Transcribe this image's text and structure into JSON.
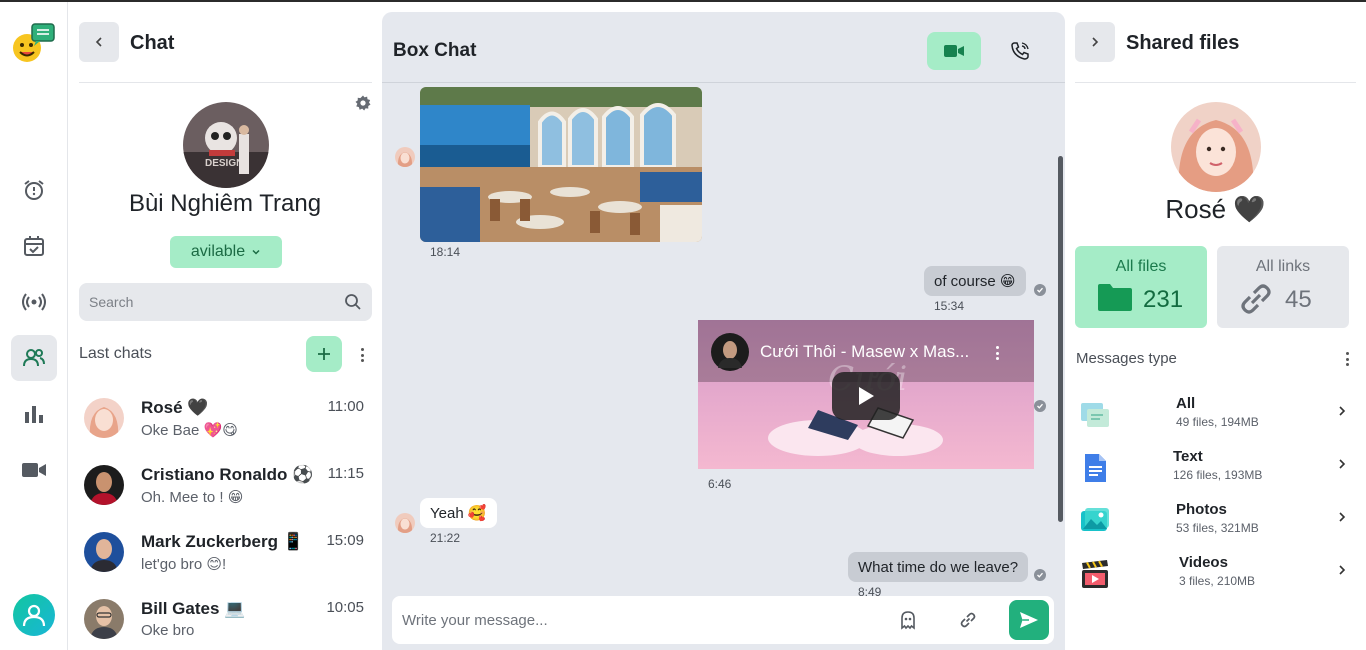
{
  "chat_panel": {
    "title": "Chat",
    "profile": {
      "name": "Bùi Nghiêm Trang",
      "status": "avilable"
    },
    "search": {
      "placeholder": "Search"
    },
    "last_chats_label": "Last chats",
    "chats": [
      {
        "name": "Rosé 🖤",
        "time": "11:00",
        "preview": "Oke Bae 💖😋"
      },
      {
        "name": "Cristiano Ronaldo ⚽",
        "time": "11:15",
        "preview": "Oh. Mee to ! 😁"
      },
      {
        "name": "Mark Zuckerberg 📱",
        "time": "15:09",
        "preview": "let'go bro 😊!"
      },
      {
        "name": "Bill Gates 💻",
        "time": "10:05",
        "preview": "Oke bro"
      }
    ]
  },
  "box_chat": {
    "title": "Box Chat",
    "messages": [
      {
        "type": "photo",
        "direction": "in",
        "time": "18:14"
      },
      {
        "type": "text",
        "direction": "out",
        "text": "of course 😁",
        "time": "15:34"
      },
      {
        "type": "video",
        "direction": "out",
        "video_title": "Cưới Thôi - Masew x Mas...",
        "time": "6:46"
      },
      {
        "type": "text",
        "direction": "in",
        "text": "Yeah 🥰",
        "time": "21:22"
      },
      {
        "type": "text",
        "direction": "out",
        "text": "What time do we leave?",
        "time": "8:49"
      }
    ],
    "composer": {
      "placeholder": "Write your message..."
    }
  },
  "files_panel": {
    "title": "Shared files",
    "contact": {
      "name": "Rosé 🖤"
    },
    "all_files": {
      "label": "All files",
      "count": "231"
    },
    "all_links": {
      "label": "All links",
      "count": "45"
    },
    "messages_type_label": "Messages type",
    "types": [
      {
        "name": "All",
        "meta": "49 files, 194MB",
        "icon": "all-files-icon"
      },
      {
        "name": "Text",
        "meta": "126 files, 193MB",
        "icon": "document-icon"
      },
      {
        "name": "Photos",
        "meta": "53 files, 321MB",
        "icon": "photo-icon"
      },
      {
        "name": "Videos",
        "meta": "3 files, 210MB",
        "icon": "video-clapper-icon"
      }
    ]
  },
  "colors": {
    "accent_green": "#a5ecc7",
    "send_green": "#22b07d",
    "folder_green": "#159a55",
    "chat_background": "#e5e8ee"
  }
}
